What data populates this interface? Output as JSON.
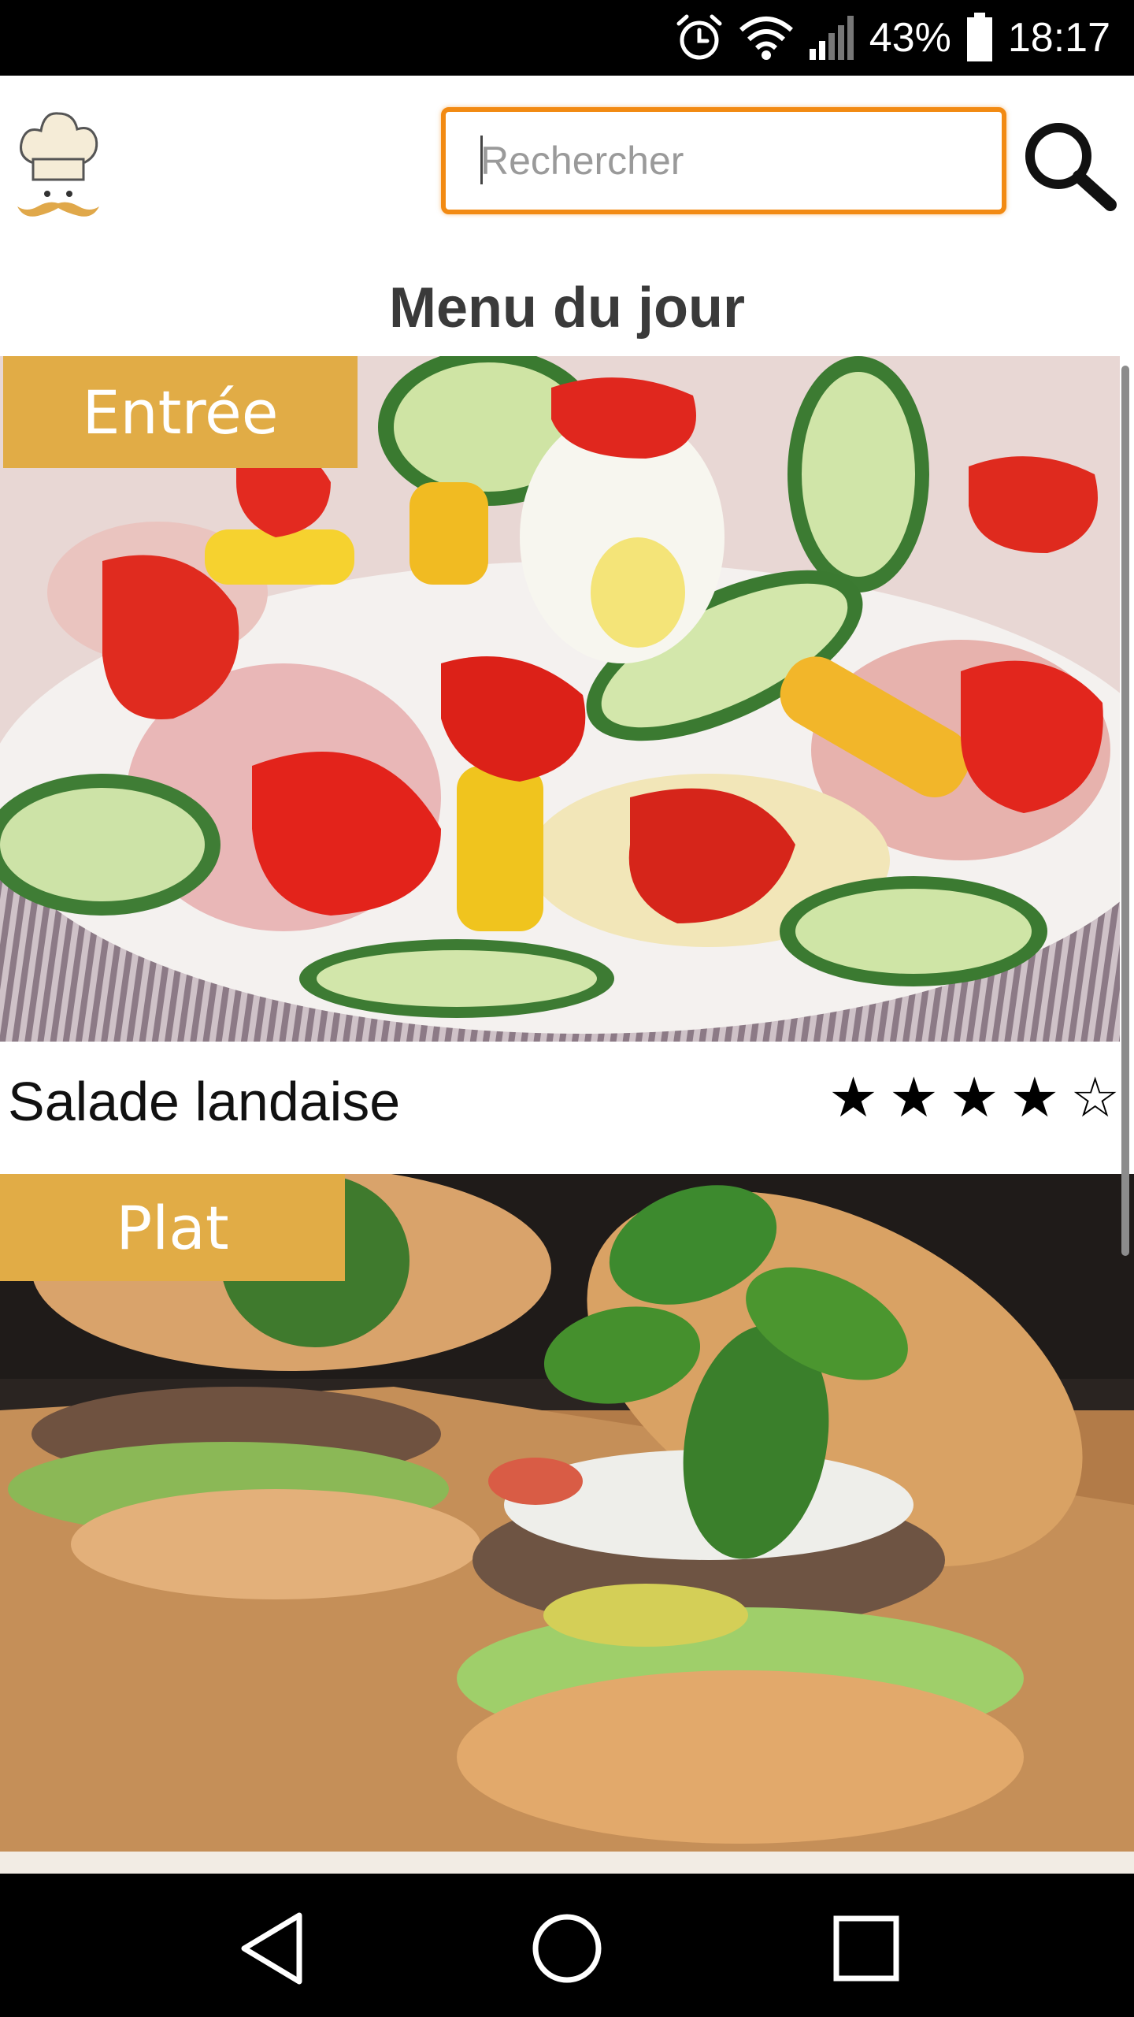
{
  "status_bar": {
    "battery_percent": "43%",
    "time": "18:17",
    "icons": [
      "alarm-icon",
      "wifi-icon",
      "signal-icon",
      "battery-icon"
    ]
  },
  "header": {
    "logo": "chef-hat-logo",
    "search": {
      "placeholder": "Rechercher",
      "value": ""
    },
    "search_icon": "magnifier-icon"
  },
  "title": "Menu du jour",
  "menu": [
    {
      "category": "Entrée",
      "dish_name": "Salade landaise",
      "rating": {
        "value": 4,
        "max": 5
      },
      "image": "salad-photo"
    },
    {
      "category": "Plat",
      "image": "burger-photo"
    }
  ],
  "colors": {
    "accent_orange": "#f28a12",
    "label_gold": "#e1ac46",
    "title_text": "#3a3a3a"
  },
  "nav": {
    "icons": [
      "back-icon",
      "home-icon",
      "recents-icon"
    ]
  }
}
